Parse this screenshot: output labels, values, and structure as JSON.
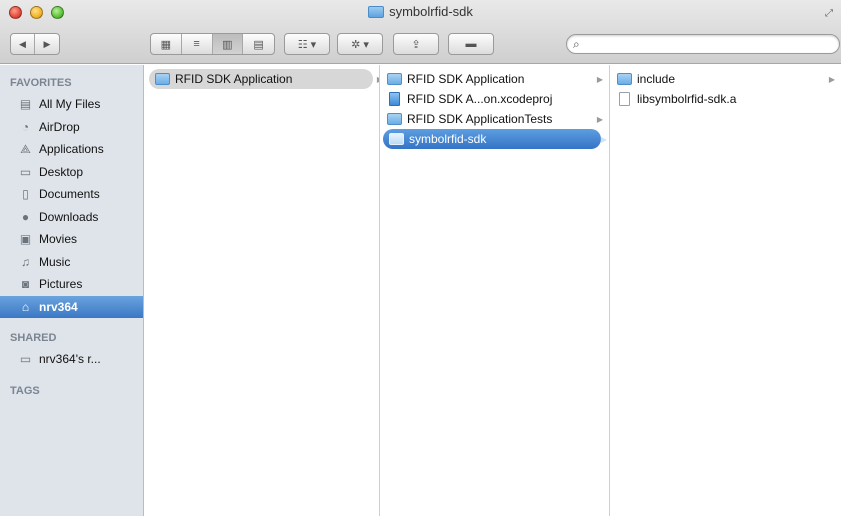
{
  "window": {
    "title": "symbolrfid-sdk"
  },
  "toolbar": {
    "back_glyph": "◀",
    "forward_glyph": "▶",
    "view_icon_glyph": "▦",
    "view_list_glyph": "≡",
    "view_column_glyph": "▥",
    "view_coverflow_glyph": "▤",
    "arrange_glyph": "☷ ▾",
    "action_glyph": "✲ ▾",
    "share_glyph": "⇪",
    "tag_glyph": "▬",
    "search_placeholder": "",
    "search_value": ""
  },
  "sidebar": {
    "favorites_header": "FAVORITES",
    "shared_header": "SHARED",
    "tags_header": "TAGS",
    "favorites": [
      {
        "label": "All My Files",
        "icon": "all-files-icon"
      },
      {
        "label": "AirDrop",
        "icon": "airdrop-icon"
      },
      {
        "label": "Applications",
        "icon": "applications-icon"
      },
      {
        "label": "Desktop",
        "icon": "desktop-icon"
      },
      {
        "label": "Documents",
        "icon": "documents-icon"
      },
      {
        "label": "Downloads",
        "icon": "downloads-icon"
      },
      {
        "label": "Movies",
        "icon": "movies-icon"
      },
      {
        "label": "Music",
        "icon": "music-icon"
      },
      {
        "label": "Pictures",
        "icon": "pictures-icon"
      },
      {
        "label": "nrv364",
        "icon": "home-icon",
        "selected": true
      }
    ],
    "shared": [
      {
        "label": "nrv364's r...",
        "icon": "computer-icon"
      }
    ]
  },
  "columns": [
    {
      "items": [
        {
          "label": "RFID SDK Application",
          "kind": "folder",
          "selected": "gray",
          "has_children": true
        }
      ]
    },
    {
      "items": [
        {
          "label": "RFID SDK Application",
          "kind": "folder",
          "has_children": true
        },
        {
          "label": "RFID SDK A...on.xcodeproj",
          "kind": "project",
          "has_children": false
        },
        {
          "label": "RFID SDK ApplicationTests",
          "kind": "folder",
          "has_children": true
        },
        {
          "label": "symbolrfid-sdk",
          "kind": "folder",
          "selected": "blue",
          "has_children": true
        }
      ]
    },
    {
      "items": [
        {
          "label": "include",
          "kind": "folder",
          "has_children": true
        },
        {
          "label": "libsymbolrfid-sdk.a",
          "kind": "file",
          "has_children": false
        }
      ]
    }
  ]
}
